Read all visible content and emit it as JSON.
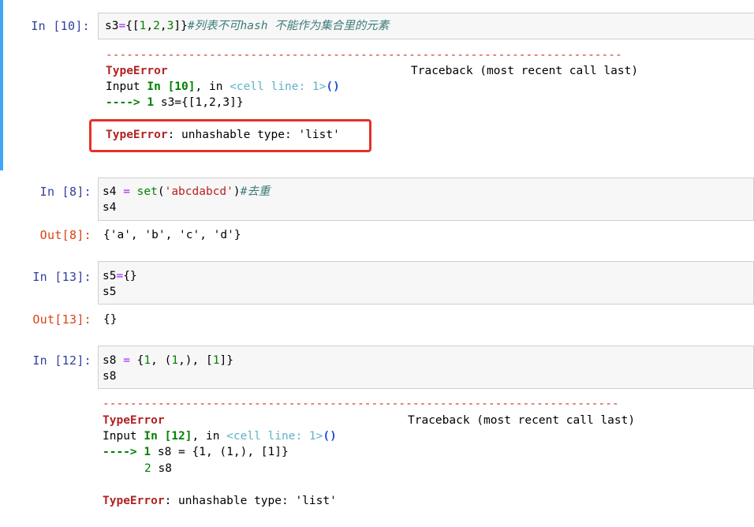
{
  "cells": [
    {
      "prompt": "In [10]:",
      "code_line1": {
        "var": "s3",
        "op": "=",
        "b1": "{[",
        "n1": "1",
        "c1": ",",
        "n2": "2",
        "c2": ",",
        "n3": "3",
        "b2": "]}",
        "comment": "#列表不可hash 不能作为集合里的元素"
      },
      "traceback": {
        "dashes": "---------------------------------------------------------------------------",
        "error_type": "TypeError",
        "traceback_label": "Traceback (most recent call last)",
        "input_prefix": "Input ",
        "input_in": "In [10]",
        "input_mid": ", in ",
        "input_cell": "<cell line: 1>",
        "input_paren": "()",
        "arrow": "----> 1",
        "arrow_code": " s3={[1,2,3]}",
        "error_msg_type": "TypeError",
        "error_msg_text": ": unhashable type: 'list'"
      }
    },
    {
      "prompt": "In [8]:",
      "line1": {
        "var": "s4 ",
        "op": "=",
        "func": " set",
        "p1": "(",
        "str": "'abcdabcd'",
        "p2": ")",
        "comment": "#去重"
      },
      "line2": "s4",
      "out_prompt": "Out[8]:",
      "output": "{'a', 'b', 'c', 'd'}"
    },
    {
      "prompt": "In [13]:",
      "line1_var": "s5",
      "line1_op": "=",
      "line1_rest": "{}",
      "line2": "s5",
      "out_prompt": "Out[13]:",
      "output": "{}"
    },
    {
      "prompt": "In [12]:",
      "line1": {
        "var": "s8 ",
        "op": "=",
        "rest_a": " {",
        "n1": "1",
        "rest_b": ", (",
        "n2": "1",
        "rest_c": ",), [",
        "n3": "1",
        "rest_d": "]}"
      },
      "line2": "s8",
      "traceback": {
        "dashes": "---------------------------------------------------------------------------",
        "error_type": "TypeError",
        "traceback_label": "Traceback (most recent call last)",
        "input_prefix": "Input ",
        "input_in": "In [12]",
        "input_mid": ", in ",
        "input_cell": "<cell line: 1>",
        "input_paren": "()",
        "arrow": "----> 1",
        "arrow_code": " s8 = {1, (1,), [1]}",
        "line2_no": "2",
        "line2_code": " s8",
        "error_msg_type": "TypeError",
        "error_msg_text": ": unhashable type: 'list'"
      }
    }
  ]
}
